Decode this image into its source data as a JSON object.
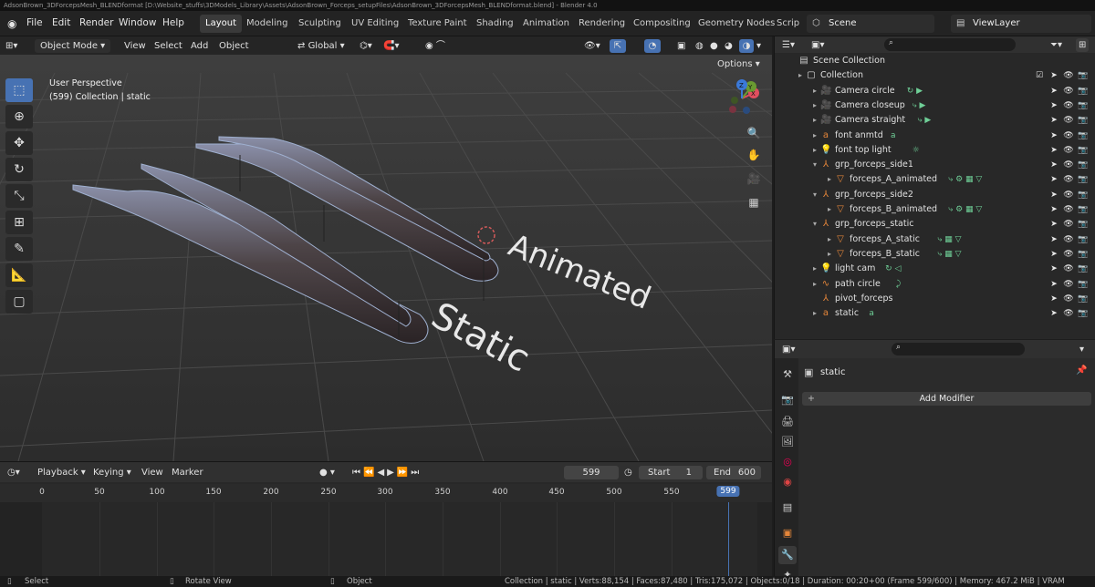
{
  "window_title": "AdsonBrown_3DForcepsMesh_BLENDformat [D:\\Website_stuffs\\3DModels_Library\\Assets\\AdsonBrown_Forceps_setupFiles\\AdsonBrown_3DForcepsMesh_BLENDformat.blend] - Blender 4.0",
  "menu": [
    "File",
    "Edit",
    "Render",
    "Window",
    "Help"
  ],
  "workspaces": [
    "Layout",
    "Modeling",
    "Sculpting",
    "UV Editing",
    "Texture Paint",
    "Shading",
    "Animation",
    "Rendering",
    "Compositing",
    "Geometry Nodes",
    "Scrip"
  ],
  "active_workspace": "Layout",
  "scene_name": "Scene",
  "view_layer": "ViewLayer",
  "viewport": {
    "mode": "Object Mode",
    "menus": [
      "View",
      "Select",
      "Add",
      "Object"
    ],
    "orientation": "Global",
    "options_label": "Options",
    "info_line1": "User Perspective",
    "info_line2": "(599) Collection | static",
    "text_animated": "Animated",
    "text_static": "Static",
    "gizmo_labels": [
      "X",
      "Y",
      "Z"
    ]
  },
  "timeline": {
    "playback": "Playback",
    "keying": "Keying",
    "view": "View",
    "marker": "Marker",
    "current_frame": "599",
    "start_label": "Start",
    "start": "1",
    "end_label": "End",
    "end": "600",
    "ticks": [
      "0",
      "50",
      "100",
      "150",
      "200",
      "250",
      "300",
      "350",
      "400",
      "450",
      "500",
      "550"
    ],
    "playhead_label": "599"
  },
  "outliner": {
    "rows": [
      {
        "label": "Scene Collection",
        "icon": "scene-collection-icon"
      },
      {
        "label": "Collection",
        "icon": "collection-icon"
      },
      {
        "label": "Camera circle",
        "icon": "camera-icon"
      },
      {
        "label": "Camera closeup",
        "icon": "camera-icon"
      },
      {
        "label": "Camera straight",
        "icon": "camera-icon"
      },
      {
        "label": "font anmtd",
        "icon": "text-icon"
      },
      {
        "label": "font top light",
        "icon": "light-icon"
      },
      {
        "label": "grp_forceps_side1",
        "icon": "empty-icon"
      },
      {
        "label": "forceps_A_animated",
        "icon": "mesh-icon"
      },
      {
        "label": "grp_forceps_side2",
        "icon": "empty-icon"
      },
      {
        "label": "forceps_B_animated",
        "icon": "mesh-icon"
      },
      {
        "label": "grp_forceps_static",
        "icon": "empty-icon"
      },
      {
        "label": "forceps_A_static",
        "icon": "mesh-icon"
      },
      {
        "label": "forceps_B_static",
        "icon": "mesh-icon"
      },
      {
        "label": "light cam",
        "icon": "light-icon"
      },
      {
        "label": "path circle",
        "icon": "curve-icon"
      },
      {
        "label": "pivot_forceps",
        "icon": "empty-icon"
      },
      {
        "label": "static",
        "icon": "text-icon"
      }
    ]
  },
  "properties": {
    "object_name": "static",
    "add_modifier": "Add Modifier"
  },
  "status": {
    "select": "Select",
    "rotate": "Rotate View",
    "object": "Object",
    "stats": "Collection | static | Verts:88,154 | Faces:87,480 | Tris:175,072 | Objects:0/18 | Duration: 00:20+00 (Frame 599/600) | Memory: 467.2 MiB | VRAM"
  },
  "colors": {
    "accent": "#4772b3",
    "object_orange": "#e5863a",
    "data_green": "#6fcf97",
    "text_white": "#f0f0f0"
  }
}
